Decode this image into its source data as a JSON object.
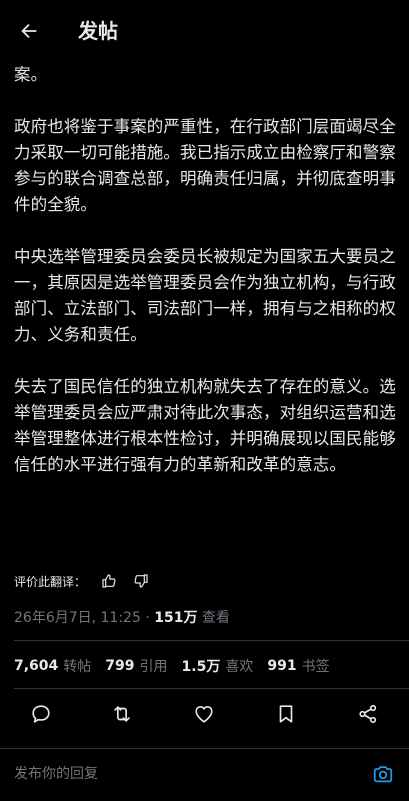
{
  "header": {
    "title": "发帖",
    "back_icon": "arrow-left-icon"
  },
  "tweet": {
    "paragraphs": [
      "案。",
      "政府也将鉴于事案的严重性，在行政部门层面竭尽全力采取一切可能措施。我已指示成立由检察厅和警察参与的联合调查总部，明确责任归属，并彻底查明事件的全貌。",
      "中央选举管理委员会委员长被规定为国家五大要员之一，其原因是选举管理委员会作为独立机构，与行政部门、立法部门、司法部门一样，拥有与之相称的权力、义务和责任。",
      "失去了国民信任的独立机构就失去了存在的意义。选举管理委员会应严肃对待此次事态，对组织运营和选举管理整体进行根本性检讨，并明确展现以国民能够信任的水平进行强有力的革新和改革的意志。"
    ]
  },
  "rating": {
    "label": "评价此翻译："
  },
  "meta": {
    "datetime": "26年6月7日, 11:25",
    "separator": " · ",
    "views_count": "151万",
    "views_label": " 查看"
  },
  "stats": [
    {
      "num": "7,604",
      "label": "转帖"
    },
    {
      "num": "799",
      "label": "引用"
    },
    {
      "num": "1.5万",
      "label": "喜欢"
    },
    {
      "num": "991",
      "label": "书签"
    }
  ],
  "reply": {
    "placeholder": "发布你的回复"
  },
  "colors": {
    "background": "#000000",
    "text": "#e7e9ea",
    "muted": "#71767b",
    "divider": "#2f3336",
    "accent": "#1d9bf0"
  }
}
